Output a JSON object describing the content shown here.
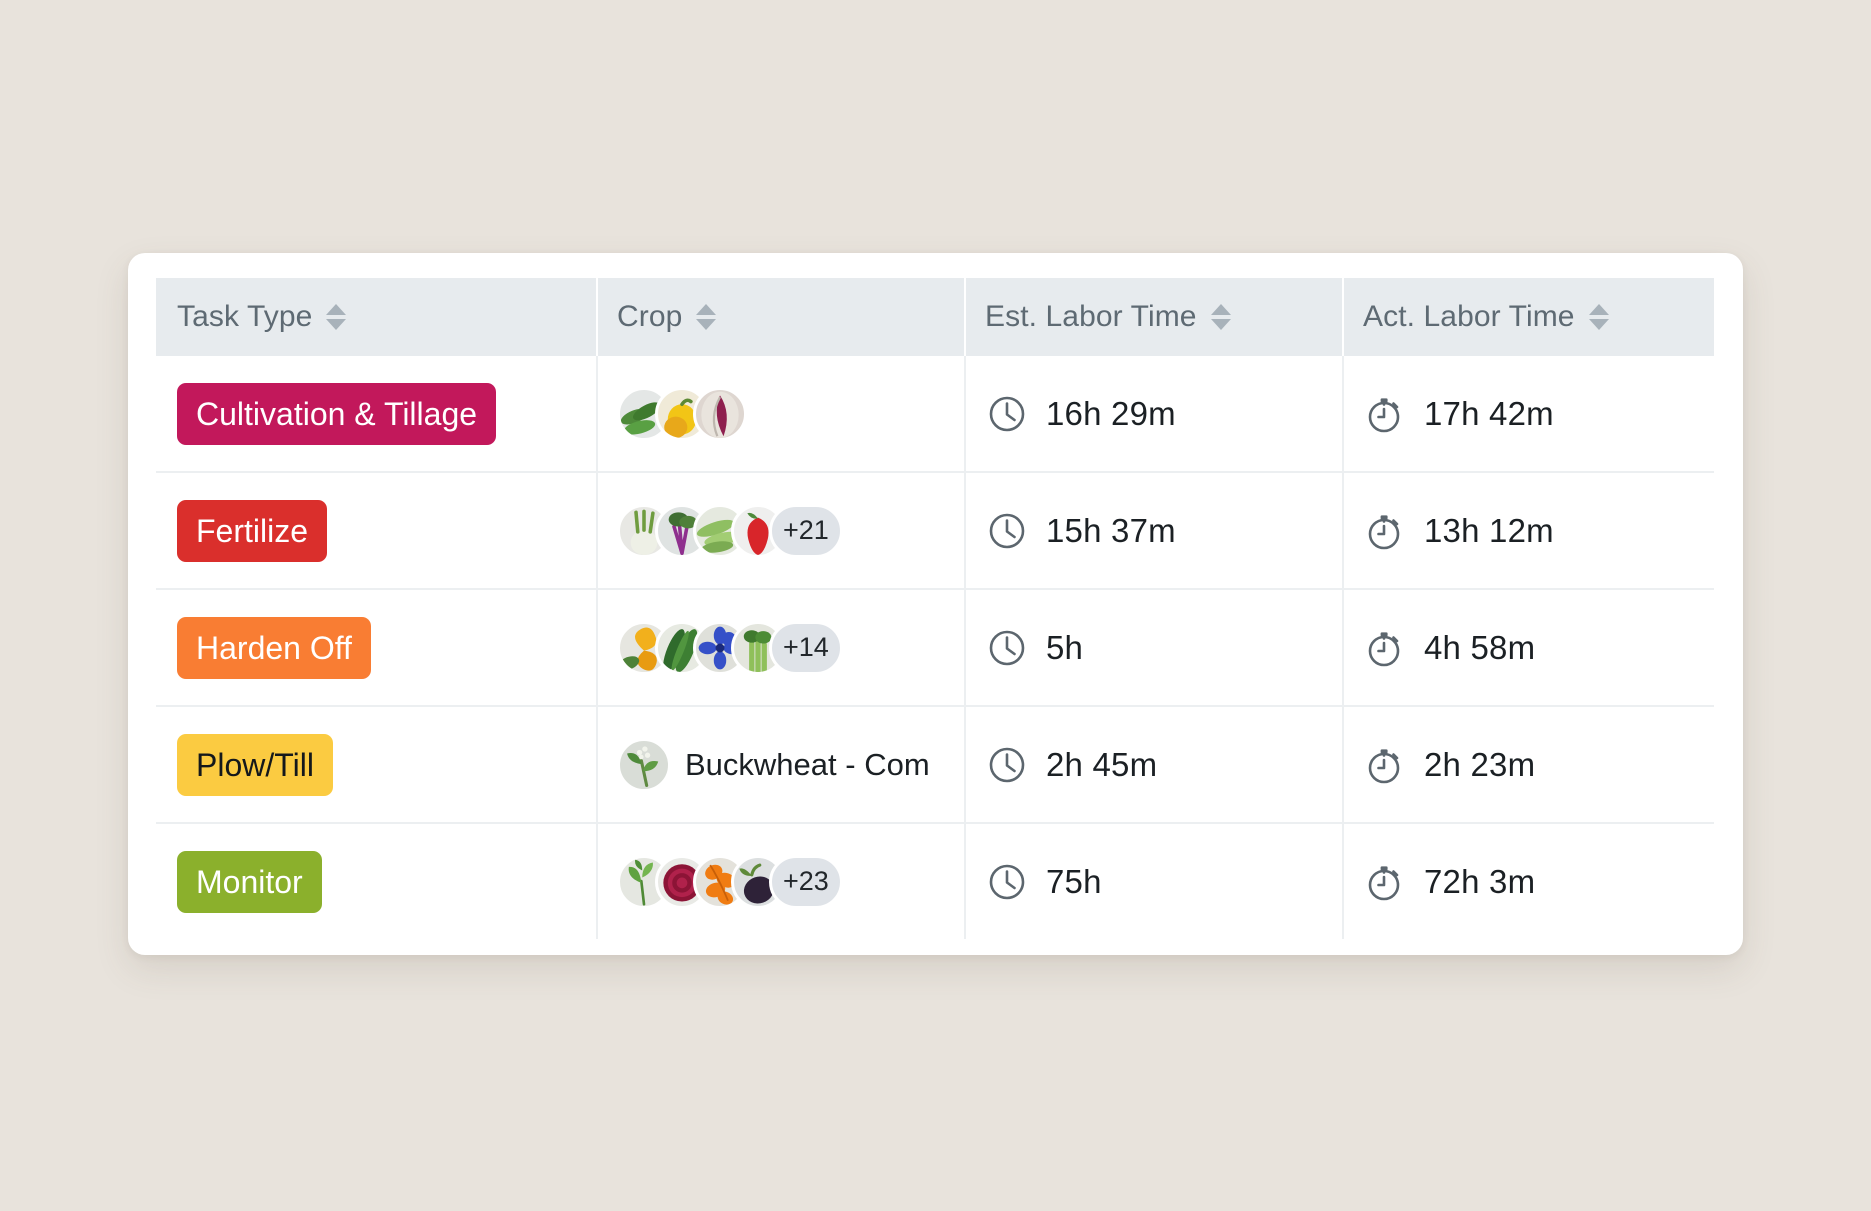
{
  "table": {
    "columns": [
      {
        "id": "task_type",
        "label": "Task Type",
        "sort_icon": "sort-arrows-icon"
      },
      {
        "id": "crop",
        "label": "Crop",
        "sort_icon": "sort-arrows-icon"
      },
      {
        "id": "est_labor_time",
        "label": "Est. Labor Time",
        "sort_icon": "sort-arrows-icon"
      },
      {
        "id": "act_labor_time",
        "label": "Act. Labor Time",
        "sort_icon": "sort-arrows-icon"
      }
    ],
    "rows": [
      {
        "task_type": "Cultivation & Tillage",
        "task_color": "#c2185b",
        "task_text_color": "#ffffff",
        "crop_label": "",
        "crop_overflow": "",
        "crop_avatar_count": 3,
        "est_labor_time": "16h 29m",
        "act_labor_time": "17h 42m",
        "est_icon": "clock-icon",
        "act_icon": "stopwatch-icon"
      },
      {
        "task_type": "Fertilize",
        "task_color": "#da2f2c",
        "task_text_color": "#ffffff",
        "crop_label": "",
        "crop_overflow": "+21",
        "crop_avatar_count": 4,
        "est_labor_time": "15h 37m",
        "act_labor_time": "13h 12m",
        "est_icon": "clock-icon",
        "act_icon": "stopwatch-icon"
      },
      {
        "task_type": "Harden Off",
        "task_color": "#f97d33",
        "task_text_color": "#ffffff",
        "crop_label": "",
        "crop_overflow": "+14",
        "crop_avatar_count": 4,
        "est_labor_time": "5h",
        "act_labor_time": "4h 58m",
        "est_icon": "clock-icon",
        "act_icon": "stopwatch-icon"
      },
      {
        "task_type": "Plow/Till",
        "task_color": "#fbcb41",
        "task_text_color": "#14181b",
        "crop_label": "Buckwheat - Com",
        "crop_overflow": "",
        "crop_avatar_count": 1,
        "est_labor_time": "2h 45m",
        "act_labor_time": "2h 23m",
        "est_icon": "clock-icon",
        "act_icon": "stopwatch-icon"
      },
      {
        "task_type": "Monitor",
        "task_color": "#8bb02c",
        "task_text_color": "#ffffff",
        "crop_label": "",
        "crop_overflow": "+23",
        "crop_avatar_count": 4,
        "est_labor_time": "75h",
        "act_labor_time": "72h 3m",
        "est_icon": "clock-icon",
        "act_icon": "stopwatch-icon"
      }
    ]
  },
  "theme": {
    "page_background": "#e8e3dc",
    "card_background": "#ffffff",
    "header_background": "#e7ebee",
    "header_text": "#5e6a73",
    "body_text": "#1b2024",
    "row_divider": "#eceff1",
    "chip_background": "#dfe3e8"
  }
}
